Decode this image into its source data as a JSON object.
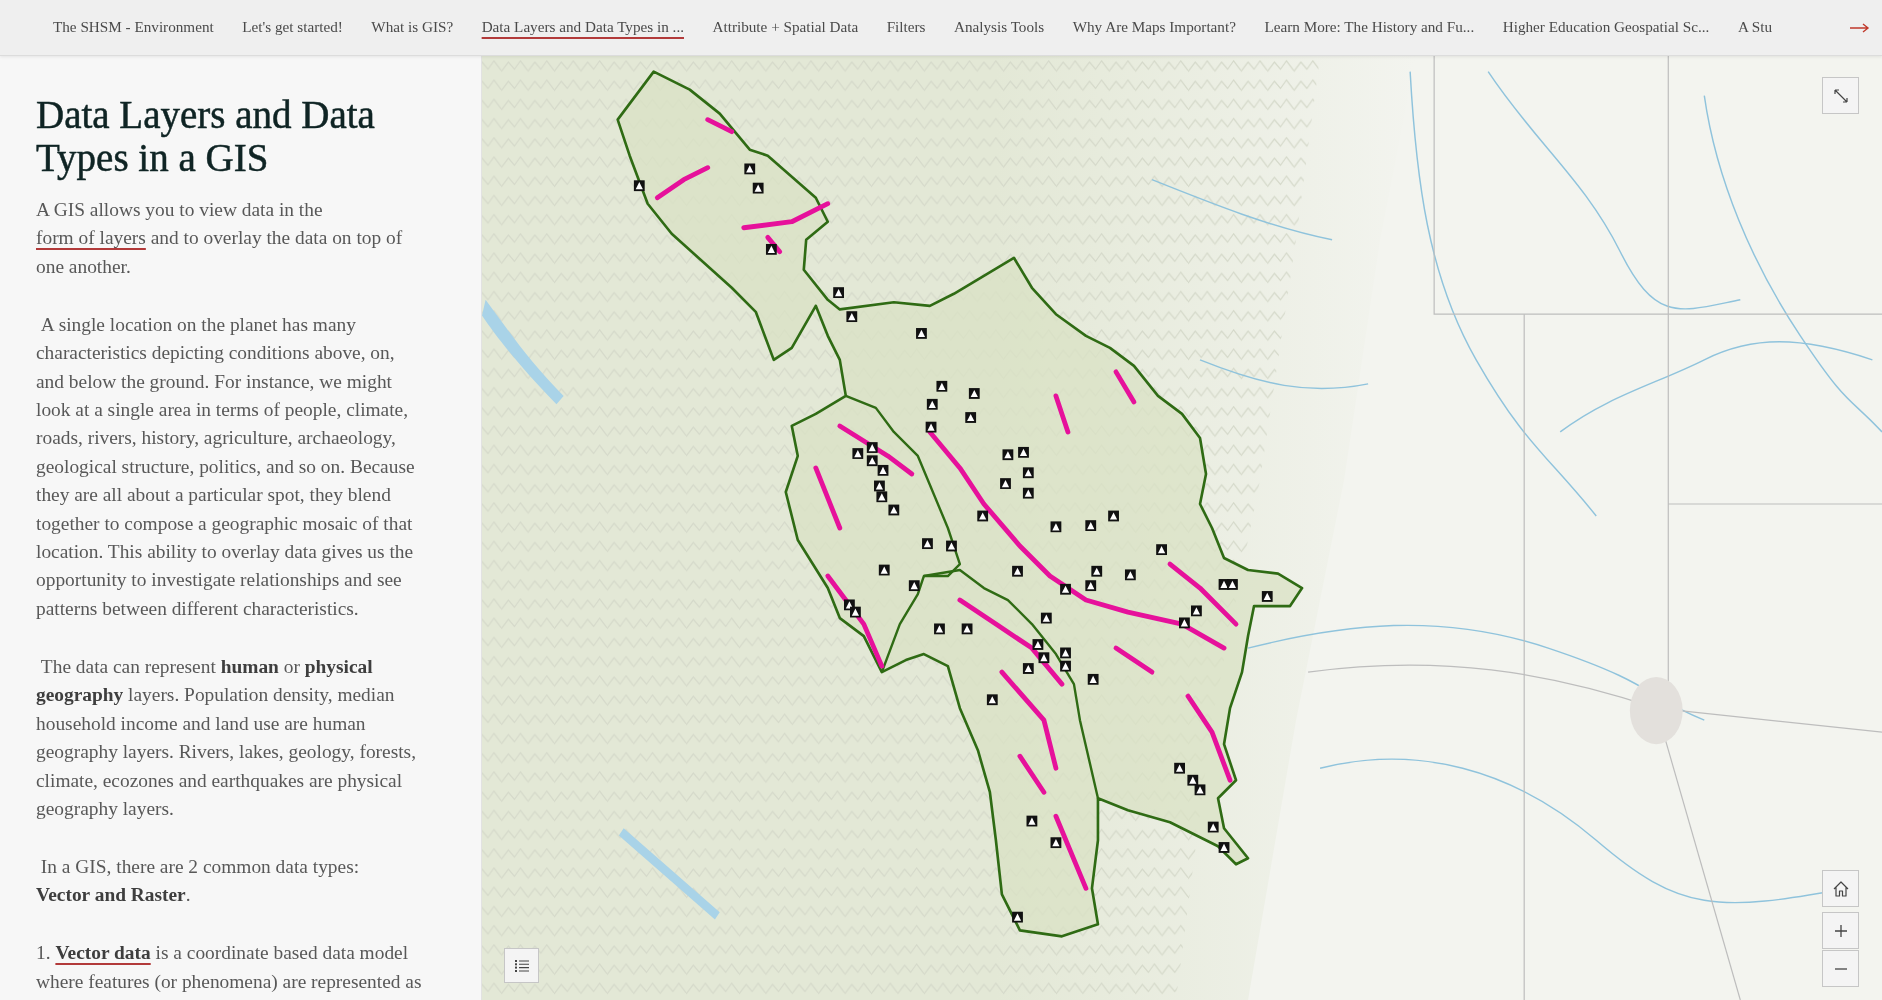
{
  "nav": {
    "tabs": [
      {
        "label": "The SHSM - Environment",
        "selected": false
      },
      {
        "label": "Let's get started!",
        "selected": false
      },
      {
        "label": "What is GIS?",
        "selected": false
      },
      {
        "label": "Data Layers and Data Types in ...",
        "selected": true
      },
      {
        "label": "Attribute + Spatial Data",
        "selected": false
      },
      {
        "label": "Filters",
        "selected": false
      },
      {
        "label": "Analysis Tools",
        "selected": false
      },
      {
        "label": "Why Are Maps Important?",
        "selected": false
      },
      {
        "label": "Learn More: The History and Fu...",
        "selected": false
      },
      {
        "label": "Higher Education Geospatial Sc...",
        "selected": false
      },
      {
        "label": "A Stu",
        "selected": false
      }
    ]
  },
  "panel": {
    "title": "Data Layers and Data Types in a GIS",
    "paragraphs": [
      {
        "parts": [
          {
            "kind": "text",
            "text": "A GIS allows you to view data in the "
          },
          {
            "kind": "link",
            "text": "form of layers",
            "bold": false
          },
          {
            "kind": "text",
            "text": " and to overlay the data on top of one another."
          }
        ]
      },
      {
        "parts": [
          {
            "kind": "text",
            "text": " A single location on the planet has many characteristics depicting conditions above, on, and below the ground. For instance, we might look at a single area in terms of people, climate, roads, rivers, history, agriculture, archaeology, geological structure, politics, and so on. Because they are all about a particular spot, they blend together to compose a geographic mosaic of that location. This ability to overlay data gives us the opportunity to investigate relationships and see patterns between different characteristics."
          }
        ]
      },
      {
        "parts": [
          {
            "kind": "text",
            "text": " The data can represent **human** or **physical geography** layers. Population density, median household income and land use are human geography layers. Rivers, lakes, geology, forests, climate, ecozones and earthquakes are physical geography layers."
          }
        ]
      },
      {
        "parts": [
          {
            "kind": "text",
            "text": " In a GIS, there are 2 common data types:\n**Vector and Raster**."
          }
        ]
      },
      {
        "parts": [
          {
            "kind": "text",
            "text": "1. "
          },
          {
            "kind": "link",
            "text": "Vector data",
            "bold": true
          },
          {
            "kind": "text",
            "text": " is a coordinate based data model where features (or phenomena) are represented as"
          }
        ]
      }
    ]
  }
}
